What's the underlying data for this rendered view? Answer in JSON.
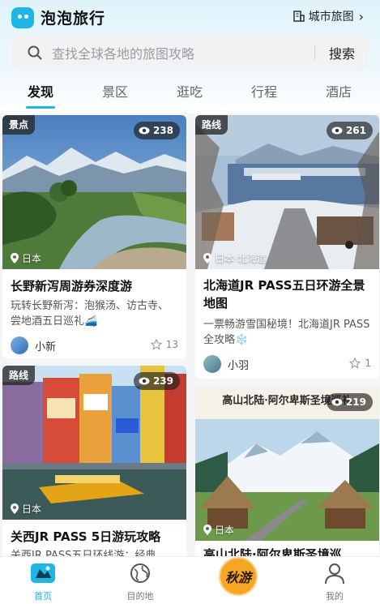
{
  "header": {
    "app_name": "泡泡旅行",
    "city_map_label": "城市旅图",
    "brand_color": "#1fb6e6"
  },
  "search": {
    "placeholder": "查找全球各地的旅图攻略",
    "button_label": "搜索"
  },
  "tabs": [
    {
      "label": "发现",
      "active": true
    },
    {
      "label": "景区",
      "active": false
    },
    {
      "label": "逛吃",
      "active": false
    },
    {
      "label": "行程",
      "active": false
    },
    {
      "label": "酒店",
      "active": false
    }
  ],
  "cards": [
    {
      "badge": "景点",
      "views": "238",
      "location": "日本",
      "title": "长野新泻周游券深度游",
      "desc": "玩转长野新泻：泡猴汤、访古寺、尝地酒五日巡礼🚄",
      "author": "小新",
      "likes": "13",
      "icon": "mountain-river-photo"
    },
    {
      "badge": "路线",
      "views": "261",
      "location": "日本·北海道",
      "title": "北海道JR PASS五日环游全景地图",
      "desc": "一票畅游雪国秘境！北海道JR PASS全攻略❄️",
      "author": "小羽",
      "likes": "1",
      "icon": "snowy-harbor-photo"
    },
    {
      "badge": "路线",
      "views": "239",
      "location": "日本",
      "title": "关西JR PASS 5日游玩攻略",
      "desc": "关西JR PASS五日环线游：经典",
      "icon": "osaka-canal-photo"
    },
    {
      "poster_title": "高山北陆·阿尔卑斯圣境巡礼",
      "views": "219",
      "location": "日本",
      "title": "高山北陆·阿尔卑斯圣境巡",
      "icon": "village-illustration"
    }
  ],
  "bottom_nav": [
    {
      "label": "首页",
      "icon": "map-home-icon",
      "active": true
    },
    {
      "label": "目的地",
      "icon": "globe-icon",
      "active": false
    },
    {
      "label": "秋游",
      "icon": "autumn-trip-icon",
      "active": false
    },
    {
      "label": "我的",
      "icon": "user-icon",
      "active": false
    }
  ]
}
